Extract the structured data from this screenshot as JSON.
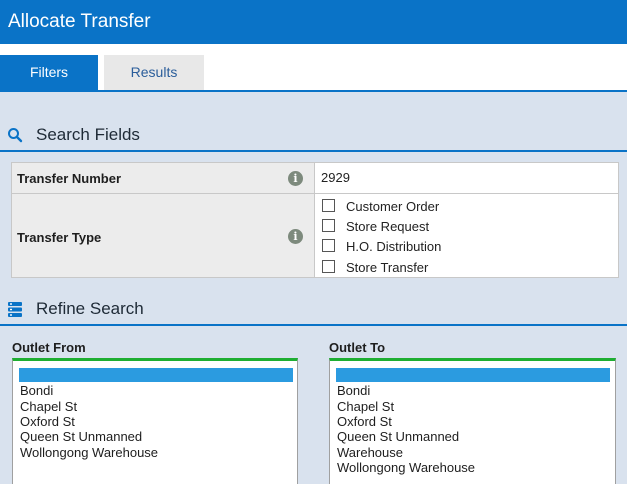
{
  "window": {
    "title": "Allocate Transfer"
  },
  "tabs": [
    {
      "label": "Filters",
      "active": true
    },
    {
      "label": "Results",
      "active": false
    }
  ],
  "search_fields": {
    "heading": "Search Fields",
    "icon": "search-icon",
    "transfer_number": {
      "label": "Transfer Number",
      "value": "2929"
    },
    "transfer_type": {
      "label": "Transfer Type",
      "options": [
        {
          "label": "Customer Order",
          "checked": false
        },
        {
          "label": "Store Request",
          "checked": false
        },
        {
          "label": "H.O. Distribution",
          "checked": false
        },
        {
          "label": "Store Transfer",
          "checked": false
        }
      ]
    }
  },
  "refine_search": {
    "heading": "Refine Search",
    "icon": "stack-icon",
    "outlet_from": {
      "label": "Outlet From",
      "items": [
        "Bondi",
        "Chapel St",
        "Oxford St",
        "Queen St Unmanned",
        "Wollongong Warehouse"
      ]
    },
    "outlet_to": {
      "label": "Outlet To",
      "items": [
        "Bondi",
        "Chapel St",
        "Oxford St",
        "Queen St Unmanned",
        "Warehouse",
        "Wollongong Warehouse"
      ]
    }
  },
  "colors": {
    "accent": "#0a73c7",
    "panel_bg": "#d9e2ee",
    "selection": "#2b9be0",
    "focus_border": "#1eae32"
  }
}
